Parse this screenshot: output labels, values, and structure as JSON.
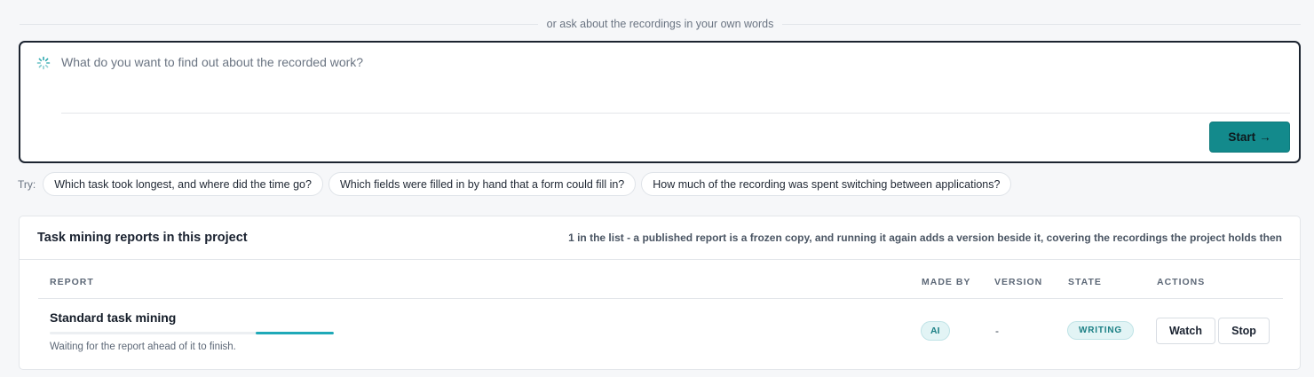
{
  "divider": {
    "text": "or ask about the recordings in your own words"
  },
  "ask": {
    "placeholder": "What do you want to find out about the recorded work?",
    "value": "",
    "start_label": "Start",
    "start_arrow": "→",
    "spinner_icon": "loading-spinner-icon"
  },
  "suggestions": {
    "label": "Try:",
    "items": [
      "Which task took longest, and where did the time go?",
      "Which fields were filled in by hand that a form could fill in?",
      "How much of the recording was spent switching between applications?"
    ]
  },
  "reports": {
    "title": "Task mining reports in this project",
    "note": "1 in the list - a published report is a frozen copy, and running it again adds a version beside it, covering the recordings the project holds then",
    "columns": [
      "REPORT",
      "MADE BY",
      "VERSION",
      "STATE",
      "ACTIONS"
    ],
    "rows": [
      {
        "name": "Standard task mining",
        "status_text": "Waiting for the report ahead of it to finish.",
        "progress_start": 0.725,
        "progress_end": 1.0,
        "made_by": "AI",
        "version": "-",
        "state": "WRITING",
        "actions": [
          "Watch",
          "Stop"
        ]
      }
    ]
  },
  "colors": {
    "accent": "#138a8c",
    "progress": "#1fa9b8",
    "badge_bg": "#e2f4f5",
    "badge_text": "#1a7f84"
  }
}
